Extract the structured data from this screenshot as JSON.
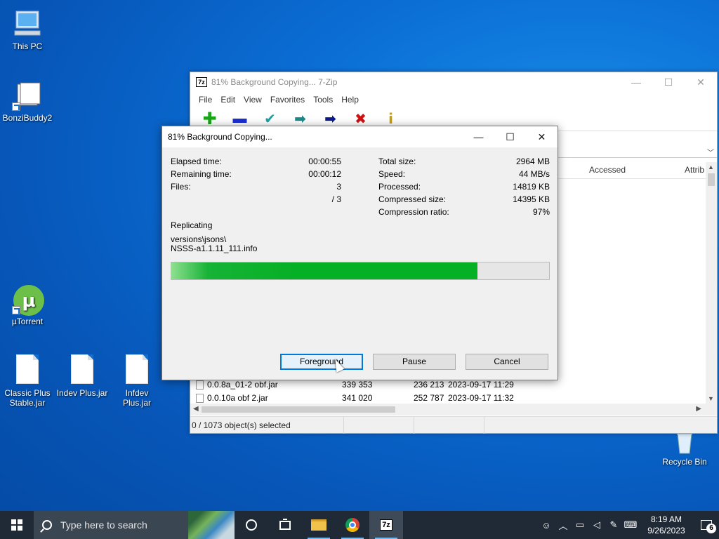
{
  "desktop": {
    "icons": [
      {
        "label": "This PC",
        "icon": "computer-icon"
      },
      {
        "label": "BonziBuddy2",
        "icon": "folder-shortcut-icon"
      },
      {
        "label": "µTorrent",
        "icon": "utorrent-icon"
      },
      {
        "label": "Classic Plus Stable.jar",
        "icon": "file-icon"
      },
      {
        "label": "Indev Plus.jar",
        "icon": "file-icon"
      },
      {
        "label": "Infdev Plus.jar",
        "icon": "file-icon"
      },
      {
        "label": "Recycle Bin",
        "icon": "recycle-bin-icon"
      }
    ]
  },
  "file_manager": {
    "title": "81% Background Copying... 7-Zip",
    "app_icon": "7z",
    "menu": [
      "File",
      "Edit",
      "View",
      "Favorites",
      "Tools",
      "Help"
    ],
    "toolbar": [
      {
        "name": "add",
        "glyph": "✚",
        "color": "#1aa51a"
      },
      {
        "name": "extract",
        "glyph": "▬",
        "color": "#1b2fd0"
      },
      {
        "name": "test",
        "glyph": "✔",
        "color": "#1aa0a0"
      },
      {
        "name": "copy",
        "glyph": "➡",
        "color": "#1a8a8a"
      },
      {
        "name": "move",
        "glyph": "➡",
        "color": "#0a1a8a"
      },
      {
        "name": "delete",
        "glyph": "✖",
        "color": "#d01010"
      },
      {
        "name": "info",
        "glyph": "ⅰ",
        "color": "#c8a000"
      }
    ],
    "columns": {
      "accessed": "Accessed",
      "attributes": "Attrib"
    },
    "rows": [
      {
        "name": "0.0.8a_01-2 obf.jar",
        "size": "339 353",
        "packed": "236 213",
        "modified": "2023-09-17 11:29"
      },
      {
        "name": "0.0.10a obf 2.jar",
        "size": "341 020",
        "packed": "252 787",
        "modified": "2023-09-17 11:32"
      }
    ],
    "status": "0 / 1073 object(s) selected"
  },
  "dialog": {
    "title": "81% Background Copying...",
    "elapsed_label": "Elapsed time:",
    "elapsed_value": "00:00:55",
    "remaining_label": "Remaining time:",
    "remaining_value": "00:00:12",
    "files_label": "Files:",
    "files_value": "3",
    "files_total": "/ 3",
    "total_size_label": "Total size:",
    "total_size_value": "2964 MB",
    "speed_label": "Speed:",
    "speed_value": "44 MB/s",
    "processed_label": "Processed:",
    "processed_value": "14819 KB",
    "compressed_label": "Compressed size:",
    "compressed_value": "14395 KB",
    "ratio_label": "Compression ratio:",
    "ratio_value": "97%",
    "operation": "Replicating",
    "current_path": "versions\\jsons\\",
    "current_file": "NSSS-a1.1.11_111.info",
    "progress": 0.81,
    "buttons": {
      "foreground": "Foreground",
      "pause": "Pause",
      "cancel": "Cancel"
    }
  },
  "taskbar": {
    "search_placeholder": "Type here to search",
    "apps": [
      "file-explorer-icon",
      "chrome-icon",
      "7zip-icon"
    ],
    "zip_label": "7z",
    "clock_time": "8:19 AM",
    "clock_date": "9/26/2023",
    "notification_count": "6"
  },
  "colors": {
    "progress_fill": "#06b025",
    "accent": "#0078d7",
    "taskbar": "#1f2a36"
  }
}
